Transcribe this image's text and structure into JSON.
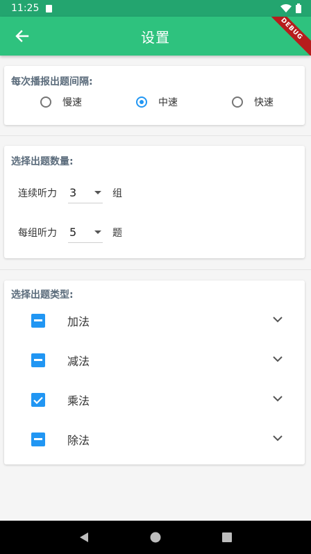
{
  "status_bar": {
    "time": "11:25"
  },
  "app_bar": {
    "title": "设置",
    "debug_label": "DEBUG"
  },
  "interval_section": {
    "title": "每次播报出题间隔:",
    "options": [
      {
        "label": "慢速",
        "selected": false
      },
      {
        "label": "中速",
        "selected": true
      },
      {
        "label": "快速",
        "selected": false
      }
    ]
  },
  "count_section": {
    "title": "选择出题数量:",
    "rows": [
      {
        "label": "连续听力",
        "value": "3",
        "unit": "组"
      },
      {
        "label": "每组听力",
        "value": "5",
        "unit": "题"
      }
    ]
  },
  "type_section": {
    "title": "选择出题类型:",
    "items": [
      {
        "label": "加法",
        "state": "indeterminate"
      },
      {
        "label": "减法",
        "state": "indeterminate"
      },
      {
        "label": "乘法",
        "state": "checked"
      },
      {
        "label": "除法",
        "state": "indeterminate"
      }
    ]
  },
  "colors": {
    "app_bar": "#2ec27e",
    "status_bar": "#23a56f",
    "accent": "#2196f3"
  },
  "icons": {
    "back": "arrow-left-icon",
    "expand": "chevron-down-icon",
    "nav": [
      "back-triangle-icon",
      "home-circle-icon",
      "recents-square-icon"
    ]
  }
}
